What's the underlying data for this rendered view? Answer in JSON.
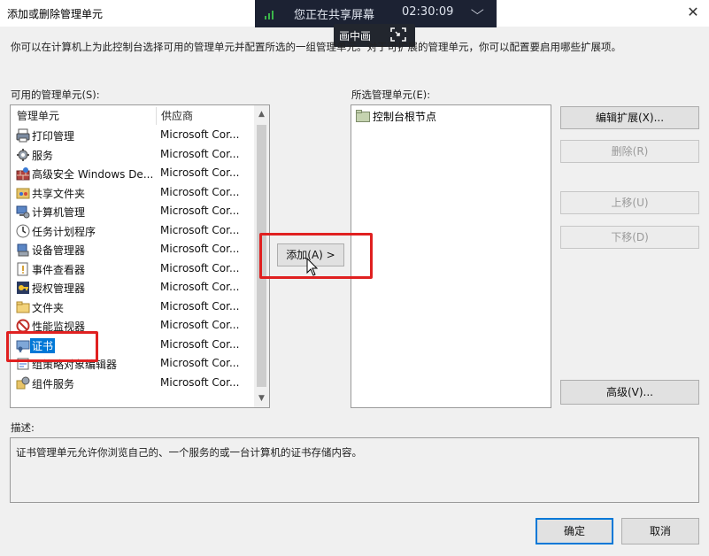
{
  "window": {
    "title": "添加或删除管理单元",
    "close_glyph": "✕"
  },
  "share_bar": {
    "status_text": "您正在共享屏幕",
    "time": "02:30:09",
    "chevron": "⌵"
  },
  "pip": {
    "label": "画中画"
  },
  "instructions": "你可以在计算机上为此控制台选择可用的管理单元并配置所选的一组管理单元。对于可扩展的管理单元，你可以配置要启用哪些扩展项。",
  "available": {
    "label": "可用的管理单元(S):",
    "columns": {
      "name": "管理单元",
      "vendor": "供应商"
    },
    "items": [
      {
        "name": "打印管理",
        "vendor": "Microsoft Cor...",
        "icon": "printer-icon"
      },
      {
        "name": "服务",
        "vendor": "Microsoft Cor...",
        "icon": "services-gear-icon"
      },
      {
        "name": "高级安全 Windows De...",
        "vendor": "Microsoft Cor...",
        "icon": "firewall-icon"
      },
      {
        "name": "共享文件夹",
        "vendor": "Microsoft Cor...",
        "icon": "shared-folder-icon"
      },
      {
        "name": "计算机管理",
        "vendor": "Microsoft Cor...",
        "icon": "computer-management-icon"
      },
      {
        "name": "任务计划程序",
        "vendor": "Microsoft Cor...",
        "icon": "clock-icon"
      },
      {
        "name": "设备管理器",
        "vendor": "Microsoft Cor...",
        "icon": "device-manager-icon"
      },
      {
        "name": "事件查看器",
        "vendor": "Microsoft Cor...",
        "icon": "event-viewer-icon"
      },
      {
        "name": "授权管理器",
        "vendor": "Microsoft Cor...",
        "icon": "authorization-icon"
      },
      {
        "name": "文件夹",
        "vendor": "Microsoft Cor...",
        "icon": "folder-icon"
      },
      {
        "name": "性能监视器",
        "vendor": "Microsoft Cor...",
        "icon": "no-entry-icon"
      },
      {
        "name": "证书",
        "vendor": "Microsoft Cor...",
        "icon": "certificate-icon"
      },
      {
        "name": "组策略对象编辑器",
        "vendor": "Microsoft Cor...",
        "icon": "group-policy-icon"
      },
      {
        "name": "组件服务",
        "vendor": "Microsoft Cor...",
        "icon": "component-services-icon"
      }
    ]
  },
  "add_button": "添加(A) >",
  "selected": {
    "label": "所选管理单元(E):",
    "items": [
      {
        "name": "控制台根节点",
        "icon": "console-root-folder-icon"
      }
    ]
  },
  "side_buttons": {
    "edit_ext": "编辑扩展(X)...",
    "remove": "删除(R)",
    "move_up": "上移(U)",
    "move_down": "下移(D)",
    "advanced": "高级(V)..."
  },
  "description": {
    "label": "描述:",
    "text": "证书管理单元允许你浏览自己的、一个服务的或一台计算机的证书存储内容。"
  },
  "footer": {
    "ok": "确定",
    "cancel": "取消"
  },
  "colors": {
    "accent": "#0078d7",
    "highlight_box": "#e02020"
  }
}
